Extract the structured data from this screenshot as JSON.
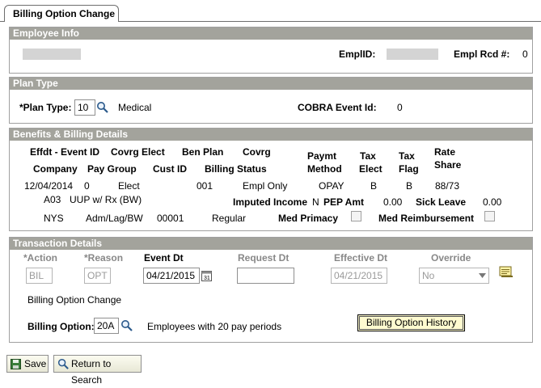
{
  "tab": {
    "label": "Billing Option Change"
  },
  "employee_info": {
    "title": "Employee Info",
    "emplid_label": "EmplID:",
    "empl_rcd_label": "Empl Rcd #:",
    "empl_rcd_value": "0"
  },
  "plan_type": {
    "title": "Plan Type",
    "plan_type_label": "*Plan Type:",
    "plan_type_value": "10",
    "plan_type_desc": "Medical",
    "cobra_label": "COBRA Event Id:",
    "cobra_value": "0"
  },
  "benefits": {
    "title": "Benefits & Billing Details",
    "headers": {
      "effdt_event": "Effdt - Event ID",
      "covrg_elect": "Covrg Elect",
      "ben_plan": "Ben Plan",
      "covrg": "Covrg",
      "paymt": "Paymt",
      "tax1": "Tax",
      "tax2": "Tax",
      "rate": "Rate",
      "company": "Company",
      "pay_group": "Pay Group",
      "cust_id": "Cust ID",
      "billing_status": "Billing Status",
      "method": "Method",
      "elect": "Elect",
      "flag": "Flag",
      "share": "Share"
    },
    "row1": {
      "effdt": "12/04/2014",
      "event_id": "0",
      "covrg_elect": "Elect",
      "ben_plan": "001",
      "covrg": "Empl Only",
      "paymt_method": "OPAY",
      "tax_elect": "B",
      "tax_flag": "B",
      "rate_share": "88/73"
    },
    "row2": {
      "plan_code": "A03",
      "plan_desc": "UUP w/ Rx (BW)",
      "imputed_label": "Imputed Income",
      "imputed_value": "N",
      "pep_label": "PEP Amt",
      "pep_value": "0.00",
      "sick_label": "Sick Leave",
      "sick_value": "0.00"
    },
    "row3": {
      "company": "NYS",
      "pay_group": "Adm/Lag/BW",
      "cust_id": "00001",
      "billing_status": "Regular",
      "med_primacy_label": "Med Primacy",
      "med_reimb_label": "Med Reimbursement"
    }
  },
  "transaction": {
    "title": "Transaction Details",
    "action_label": "*Action",
    "reason_label": "*Reason",
    "event_dt_label": "Event Dt",
    "request_dt_label": "Request Dt",
    "effective_dt_label": "Effective Dt",
    "override_label": "Override",
    "action_value": "BIL",
    "reason_value": "OPT",
    "event_dt_value": "04/21/2015",
    "request_dt_value": "",
    "effective_dt_value": "04/21/2015",
    "override_value": "No",
    "description": "Billing Option Change",
    "billing_option_label": "Billing Option:",
    "billing_option_value": "20A",
    "billing_option_desc": "Employees with 20 pay periods",
    "history_button": "Billing Option History"
  },
  "footer": {
    "save_label": "Save",
    "return_label": "Return to Search"
  }
}
